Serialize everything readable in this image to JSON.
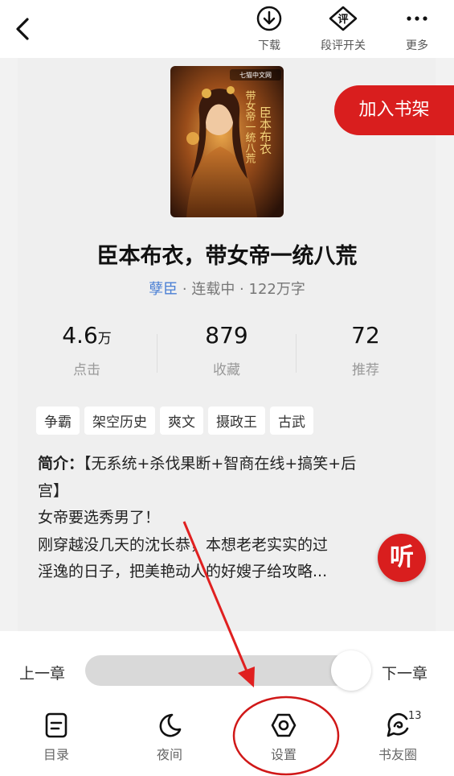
{
  "topbar": {
    "download_label": "下载",
    "comments_label": "段评开关",
    "more_label": "更多",
    "comments_icon_text": "评"
  },
  "cover": {
    "publisher": "七猫中文网",
    "calligraphy_right": "臣本布衣",
    "calligraphy_left": "带女帝一统八荒"
  },
  "add_to_shelf": "加入书架",
  "book": {
    "title": "臣本布衣，带女帝一统八荒",
    "author": "孽臣",
    "meta_rest": " · 连载中 · 122万字"
  },
  "stats": [
    {
      "value": "4.6",
      "unit": "万",
      "label": "点击"
    },
    {
      "value": "879",
      "unit": "",
      "label": "收藏"
    },
    {
      "value": "72",
      "unit": "",
      "label": "推荐"
    }
  ],
  "tags": [
    "争霸",
    "架空历史",
    "爽文",
    "摄政王",
    "古武"
  ],
  "intro": {
    "heading": "简介：",
    "line1": "【无系统+杀伐果断+智商在线+搞笑+后",
    "line2": "宫】",
    "line3": "女帝要选秀男了！",
    "line4": "刚穿越没几天的沈长恭，本想老老实实的过",
    "line5": "淫逸的日子，把美艳动人的好嫂子给攻略..."
  },
  "listen_label": "听",
  "reader": {
    "prev_chapter": "上一章",
    "next_chapter": "下一章",
    "progress_percent": 95
  },
  "bottom_nav": {
    "catalog": "目录",
    "night": "夜间",
    "settings": "设置",
    "friends": "书友圈",
    "friends_badge": "13"
  },
  "colors": {
    "accent": "#d91e1e",
    "author": "#4a7fd4"
  }
}
